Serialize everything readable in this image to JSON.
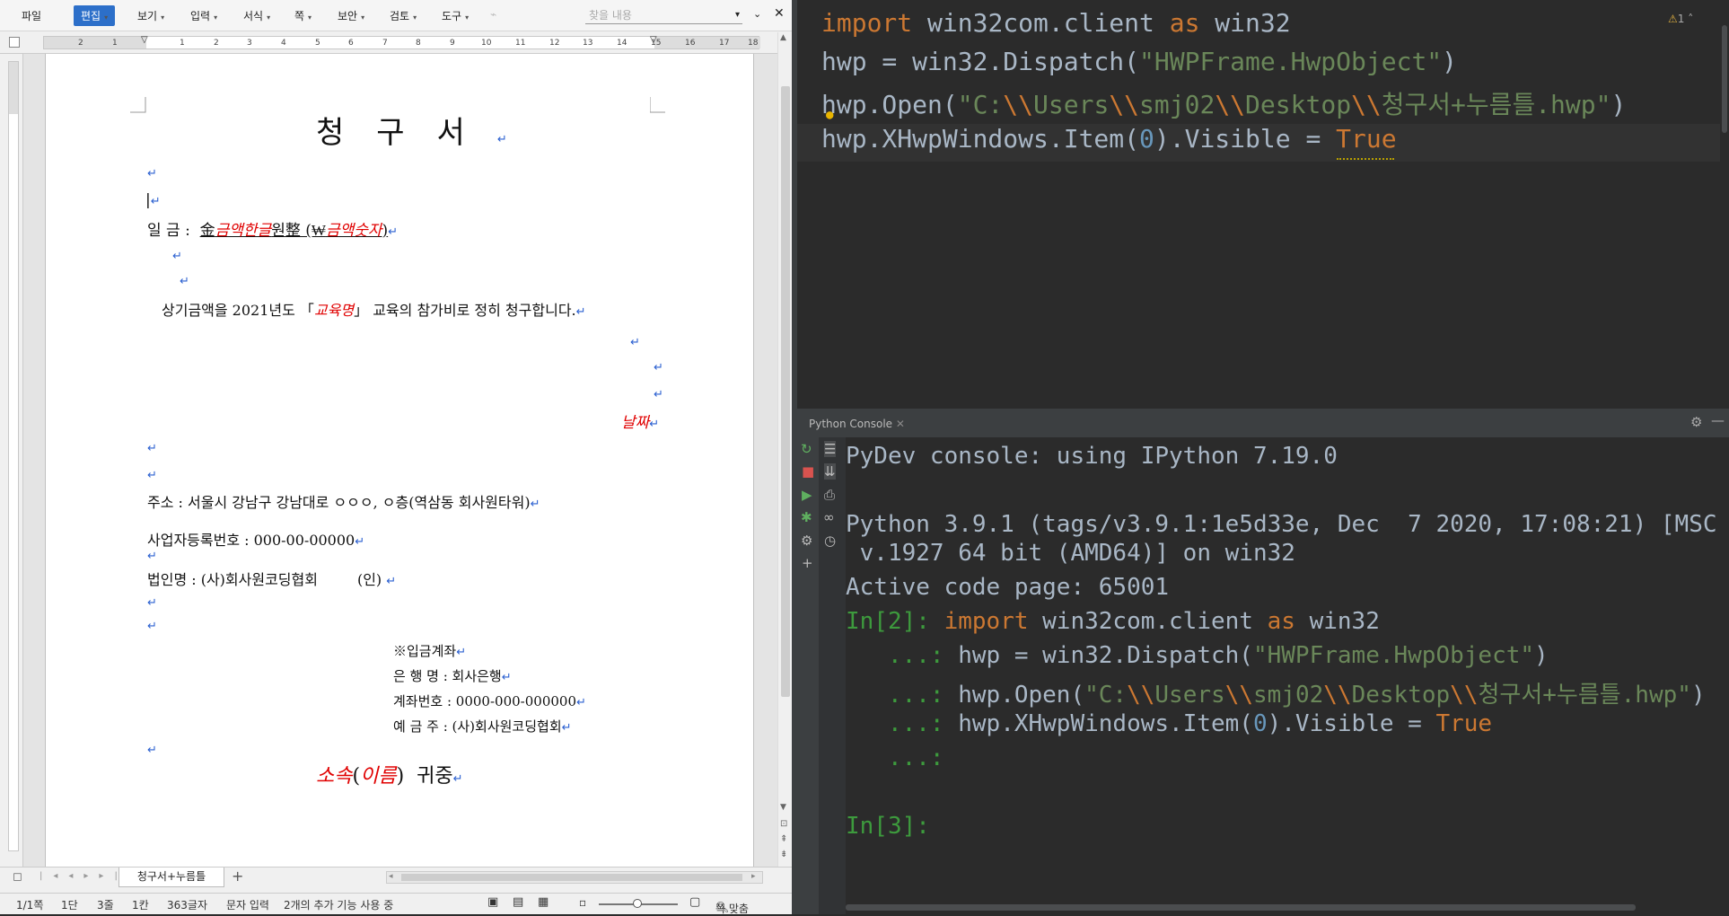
{
  "hwp": {
    "menu": [
      {
        "label": "파일"
      },
      {
        "label": "편집",
        "active": true
      },
      {
        "label": "보기"
      },
      {
        "label": "입력"
      },
      {
        "label": "서식"
      },
      {
        "label": "쪽"
      },
      {
        "label": "보안"
      },
      {
        "label": "검토"
      },
      {
        "label": "도구"
      }
    ],
    "search_placeholder": "찾을 내용",
    "ruler_numbers": [
      "2",
      "1",
      "",
      "1",
      "2",
      "3",
      "4",
      "5",
      "6",
      "7",
      "8",
      "9",
      "10",
      "11",
      "12",
      "13",
      "14",
      "15",
      "16",
      "17",
      "18"
    ],
    "document": {
      "title": "청구서",
      "amount_label": "일 금 :",
      "amount_prefix": "金",
      "amount_korean": "금액한글",
      "amount_mid": "원整 (₩",
      "amount_number": "금액숫자",
      "amount_suffix": ")",
      "body_prefix": "상기금액을 2021년도 「",
      "course": "교육명",
      "body_suffix": "」 교육의 참가비로 정히 청구합니다.",
      "date": "날짜",
      "address": "주소 : 서울시 강남구 강남대로 ㅇㅇㅇ, ㅇ층(역삼동 회사원타워)",
      "biz_number": "사업자등록번호 : 000-00-00000",
      "corp_name": "법인명 : (사)회사원코딩협회",
      "seal": "(인)",
      "account_header": "※입금계좌",
      "bank": "은 행 명 : 회사은행",
      "account_no": "계좌번호 : 0000-000-000000",
      "depositor": "예 금 주 : (사)회사원코딩협회",
      "closing_dept": "소속",
      "closing_name": "이름",
      "closing_suffix": "귀중"
    },
    "tab_label": "청구서+누름틀",
    "status": [
      "1/1쪽",
      "1단",
      "3줄",
      "1칸",
      "363글자",
      "문자 입력",
      "2개의 추가 기능 사용 중",
      "쪽 맞춤"
    ]
  },
  "editor": {
    "warning_count": "1",
    "lines": [
      {
        "parts": [
          {
            "t": "import",
            "c": "kw"
          },
          {
            "t": " win32com.client "
          },
          {
            "t": "as",
            "c": "kw"
          },
          {
            "t": " win32"
          }
        ]
      },
      {
        "parts": [
          {
            "t": "hwp = win32.Dispatch("
          },
          {
            "t": "\"HWPFrame.HwpObject\"",
            "c": "str"
          },
          {
            "t": ")"
          }
        ]
      },
      {
        "parts": [
          {
            "t": "hwp.Open("
          },
          {
            "t": "\"C:",
            "c": "str"
          },
          {
            "t": "\\\\",
            "c": "kw"
          },
          {
            "t": "Users",
            "c": "str"
          },
          {
            "t": "\\\\",
            "c": "kw"
          },
          {
            "t": "smj02",
            "c": "str"
          },
          {
            "t": "\\\\",
            "c": "kw"
          },
          {
            "t": "Desktop",
            "c": "str"
          },
          {
            "t": "\\\\",
            "c": "kw"
          },
          {
            "t": "청구서+누름틀.hwp\"",
            "c": "str"
          },
          {
            "t": ")"
          }
        ]
      },
      {
        "parts": [
          {
            "t": "hwp.XHwpWindows.Item("
          },
          {
            "t": "0",
            "c": "num"
          },
          {
            "t": ").Visible = "
          },
          {
            "t": "True",
            "c": "kw"
          }
        ]
      }
    ]
  },
  "console": {
    "tab_title": "Python Console",
    "lines": [
      {
        "parts": [
          {
            "t": "PyDev console: using IPython 7.19.0"
          }
        ]
      },
      {
        "parts": [
          {
            "t": ""
          }
        ]
      },
      {
        "parts": [
          {
            "t": "Python 3.9.1 (tags/v3.9.1:1e5d33e, Dec  7 2020, 17:08:21) [MSC"
          }
        ]
      },
      {
        "parts": [
          {
            "t": " v.1927 64 bit (AMD64)] on win32"
          }
        ]
      },
      {
        "parts": [
          {
            "t": "Active code page: 65001"
          }
        ]
      },
      {
        "parts": [
          {
            "t": "In[2]: ",
            "c": "prompt"
          },
          {
            "t": "import",
            "c": "kw"
          },
          {
            "t": " win32com.client "
          },
          {
            "t": "as",
            "c": "kw"
          },
          {
            "t": " win32"
          }
        ]
      },
      {
        "parts": [
          {
            "t": "   ...: ",
            "c": "prompt"
          },
          {
            "t": "hwp = win32.Dispatch("
          },
          {
            "t": "\"HWPFrame.HwpObject\"",
            "c": "str"
          },
          {
            "t": ")"
          }
        ]
      },
      {
        "parts": [
          {
            "t": "   ...: ",
            "c": "prompt"
          },
          {
            "t": "hwp.Open("
          },
          {
            "t": "\"C:",
            "c": "str"
          },
          {
            "t": "\\\\",
            "c": "kw"
          },
          {
            "t": "Users",
            "c": "str"
          },
          {
            "t": "\\\\",
            "c": "kw"
          },
          {
            "t": "smj02",
            "c": "str"
          },
          {
            "t": "\\\\",
            "c": "kw"
          },
          {
            "t": "Desktop",
            "c": "str"
          },
          {
            "t": "\\\\",
            "c": "kw"
          },
          {
            "t": "청구서+누름틀.hwp\"",
            "c": "str"
          },
          {
            "t": ")"
          }
        ]
      },
      {
        "parts": [
          {
            "t": "   ...: ",
            "c": "prompt"
          },
          {
            "t": "hwp.XHwpWindows.Item("
          },
          {
            "t": "0",
            "c": "num"
          },
          {
            "t": ").Visible = "
          },
          {
            "t": "True",
            "c": "kw"
          }
        ]
      },
      {
        "parts": [
          {
            "t": "   ...: ",
            "c": "prompt"
          }
        ]
      },
      {
        "parts": [
          {
            "t": ""
          }
        ]
      },
      {
        "parts": [
          {
            "t": "In[3]:",
            "c": "prompt"
          }
        ]
      }
    ]
  }
}
